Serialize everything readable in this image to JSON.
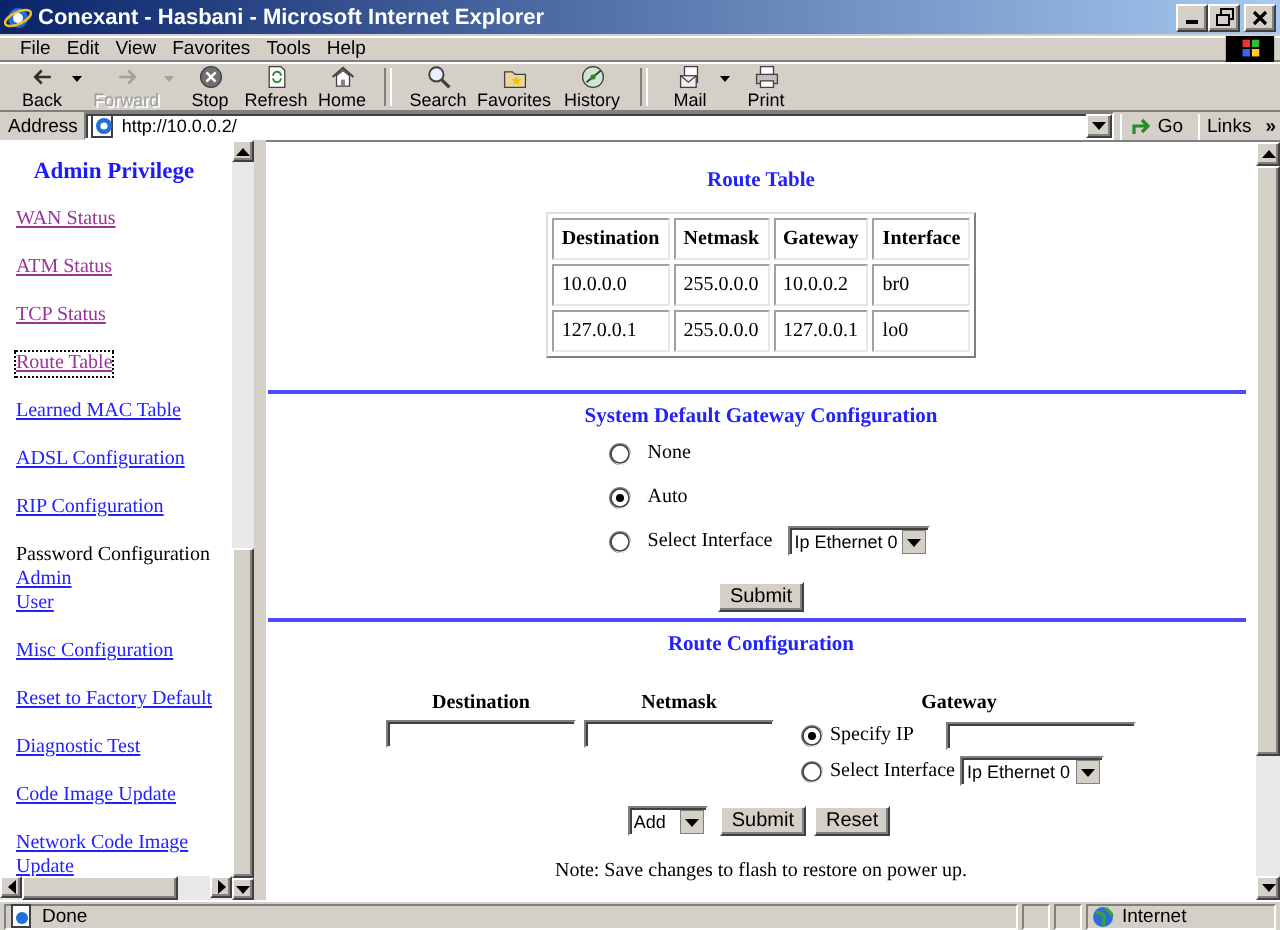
{
  "window": {
    "title": "Conexant - Hasbani - Microsoft Internet Explorer"
  },
  "menu": [
    "File",
    "Edit",
    "View",
    "Favorites",
    "Tools",
    "Help"
  ],
  "toolbar": [
    {
      "label": "Back",
      "disabled": false
    },
    {
      "label": "Forward",
      "disabled": true
    },
    {
      "label": "Stop",
      "disabled": false
    },
    {
      "label": "Refresh",
      "disabled": false
    },
    {
      "label": "Home",
      "disabled": false
    },
    {
      "label": "Search",
      "disabled": false
    },
    {
      "label": "Favorites",
      "disabled": false
    },
    {
      "label": "History",
      "disabled": false
    },
    {
      "label": "Mail",
      "disabled": false
    },
    {
      "label": "Print",
      "disabled": false
    }
  ],
  "address": {
    "label": "Address",
    "value": "http://10.0.0.2/",
    "go": "Go",
    "links": "Links",
    "links_more": "»"
  },
  "sidebar": {
    "heading": "Admin Privilege",
    "items": [
      {
        "kind": "link",
        "label": "WAN Status",
        "visited": true,
        "focused": false
      },
      {
        "kind": "link",
        "label": "ATM Status",
        "visited": true,
        "focused": false
      },
      {
        "kind": "link",
        "label": "TCP Status",
        "visited": true,
        "focused": false
      },
      {
        "kind": "link",
        "label": "Route Table",
        "visited": true,
        "focused": true
      },
      {
        "kind": "link",
        "label": "Learned MAC Table",
        "visited": false,
        "focused": false
      },
      {
        "kind": "link",
        "label": "ADSL Configuration",
        "visited": false,
        "focused": false
      },
      {
        "kind": "link",
        "label": "RIP Configuration",
        "visited": false,
        "focused": false
      },
      {
        "kind": "group",
        "label": "Password Configuration",
        "children": [
          {
            "kind": "link",
            "label": "Admin",
            "visited": false,
            "focused": false
          },
          {
            "kind": "link",
            "label": "User",
            "visited": false,
            "focused": false
          }
        ]
      },
      {
        "kind": "link",
        "label": "Misc Configuration",
        "visited": false,
        "focused": false
      },
      {
        "kind": "link",
        "label": "Reset to Factory Default",
        "visited": false,
        "focused": false
      },
      {
        "kind": "link",
        "label": "Diagnostic Test",
        "visited": false,
        "focused": false
      },
      {
        "kind": "link",
        "label": "Code Image Update",
        "visited": false,
        "focused": false
      },
      {
        "kind": "link",
        "label": "Network Code Image Update",
        "visited": false,
        "focused": false
      }
    ]
  },
  "route_table": {
    "title": "Route Table",
    "columns": [
      "Destination",
      "Netmask",
      "Gateway",
      "Interface"
    ],
    "rows": [
      [
        "10.0.0.0",
        "255.0.0.0",
        "10.0.0.2",
        "br0"
      ],
      [
        "127.0.0.1",
        "255.0.0.0",
        "127.0.0.1",
        "lo0"
      ]
    ]
  },
  "gateway_config": {
    "title": "System Default Gateway Configuration",
    "options": [
      {
        "kind": "plain",
        "label": "None",
        "selected": false
      },
      {
        "kind": "plain",
        "label": "Auto",
        "selected": true
      },
      {
        "kind": "select",
        "label": "Select Interface",
        "selected": false,
        "select": "Ip Ethernet 0"
      }
    ],
    "submit": "Submit"
  },
  "route_config": {
    "title": "Route Configuration",
    "columns": [
      "Destination",
      "Netmask",
      "Gateway"
    ],
    "gateway_options": [
      {
        "kind": "field",
        "label": "Specify IP",
        "selected": true
      },
      {
        "kind": "select",
        "label": "Select Interface",
        "selected": false,
        "select": "Ip Ethernet 0"
      }
    ],
    "action": "Add",
    "buttons": [
      "Submit",
      "Reset"
    ],
    "note": "Note: Save changes to flash to restore on power up."
  },
  "status_bar": {
    "text": "Done",
    "zone": "Internet"
  }
}
